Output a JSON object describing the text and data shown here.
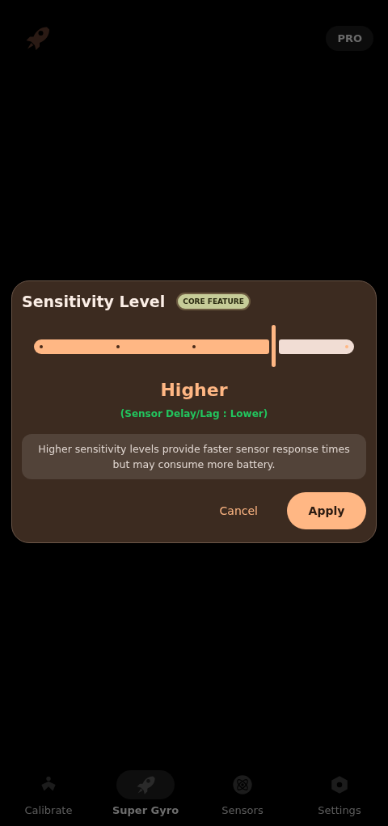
{
  "top_bar": {
    "pro_button": "PRO"
  },
  "dialog": {
    "title": "Sensitivity Level",
    "badge": "CORE FEATURE",
    "slider": {
      "level": 0.75
    },
    "value_label": "Higher",
    "delay_label": "(Sensor Delay/Lag : Lower)",
    "note": "Higher sensitivity levels provide faster sensor response times but may consume more battery.",
    "buttons": [
      {
        "label": "Cancel",
        "kind": "text"
      },
      {
        "label": "Apply",
        "kind": "filled"
      }
    ]
  },
  "nav": [
    {
      "label": "Calibrate",
      "selected": false
    },
    {
      "label": "Super Gyro",
      "selected": true
    },
    {
      "label": "Sensors",
      "selected": false
    },
    {
      "label": "Settings",
      "selected": false
    }
  ]
}
